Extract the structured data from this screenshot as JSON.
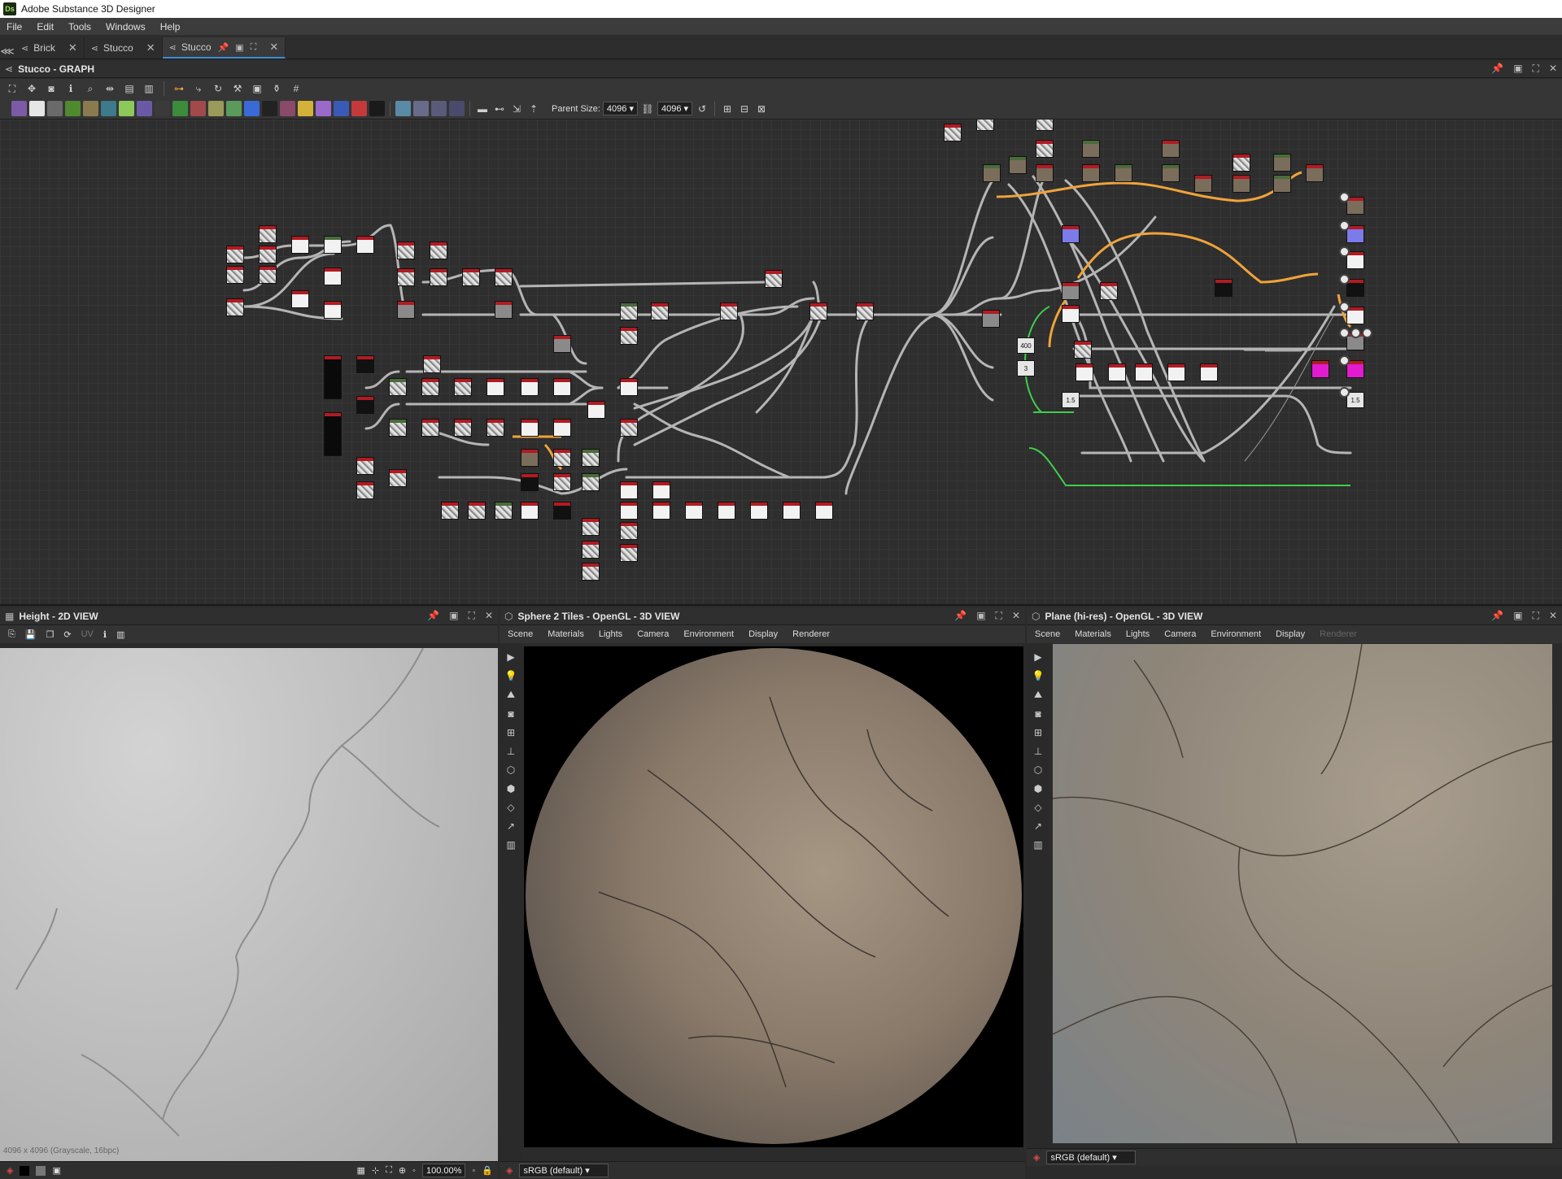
{
  "app": {
    "title": "Adobe Substance 3D Designer",
    "icon_label": "Ds"
  },
  "menu": [
    "File",
    "Edit",
    "Tools",
    "Windows",
    "Help"
  ],
  "tabs": [
    {
      "label": "Brick",
      "active": false
    },
    {
      "label": "Stucco",
      "active": false
    },
    {
      "label": "Stucco",
      "active": true
    }
  ],
  "graph": {
    "title": "Stucco - GRAPH",
    "parent_size_label": "Parent Size:",
    "parent_size_value": "4096",
    "size_value": "4096",
    "value_nodes": [
      "400",
      "3",
      "1.5",
      "1.5"
    ]
  },
  "view2d": {
    "title": "Height - 2D VIEW",
    "status": "4096 x 4096 (Grayscale, 16bpc)",
    "zoom": "100.00%",
    "uv_label": "UV"
  },
  "view3d_sphere": {
    "title": "Sphere 2 Tiles - OpenGL - 3D VIEW",
    "menu": [
      "Scene",
      "Materials",
      "Lights",
      "Camera",
      "Environment",
      "Display",
      "Renderer"
    ],
    "colorspace": "sRGB (default)"
  },
  "view3d_plane": {
    "title": "Plane (hi-res) - OpenGL - 3D VIEW",
    "menu": [
      "Scene",
      "Materials",
      "Lights",
      "Camera",
      "Environment",
      "Display",
      "Renderer"
    ],
    "colorspace": "sRGB (default)"
  },
  "colors": {
    "accent": "#3a8fd6",
    "wire_orange": "#f0a33a",
    "wire_green": "#3fcf4a",
    "wire_gray": "#b5b5b5"
  }
}
